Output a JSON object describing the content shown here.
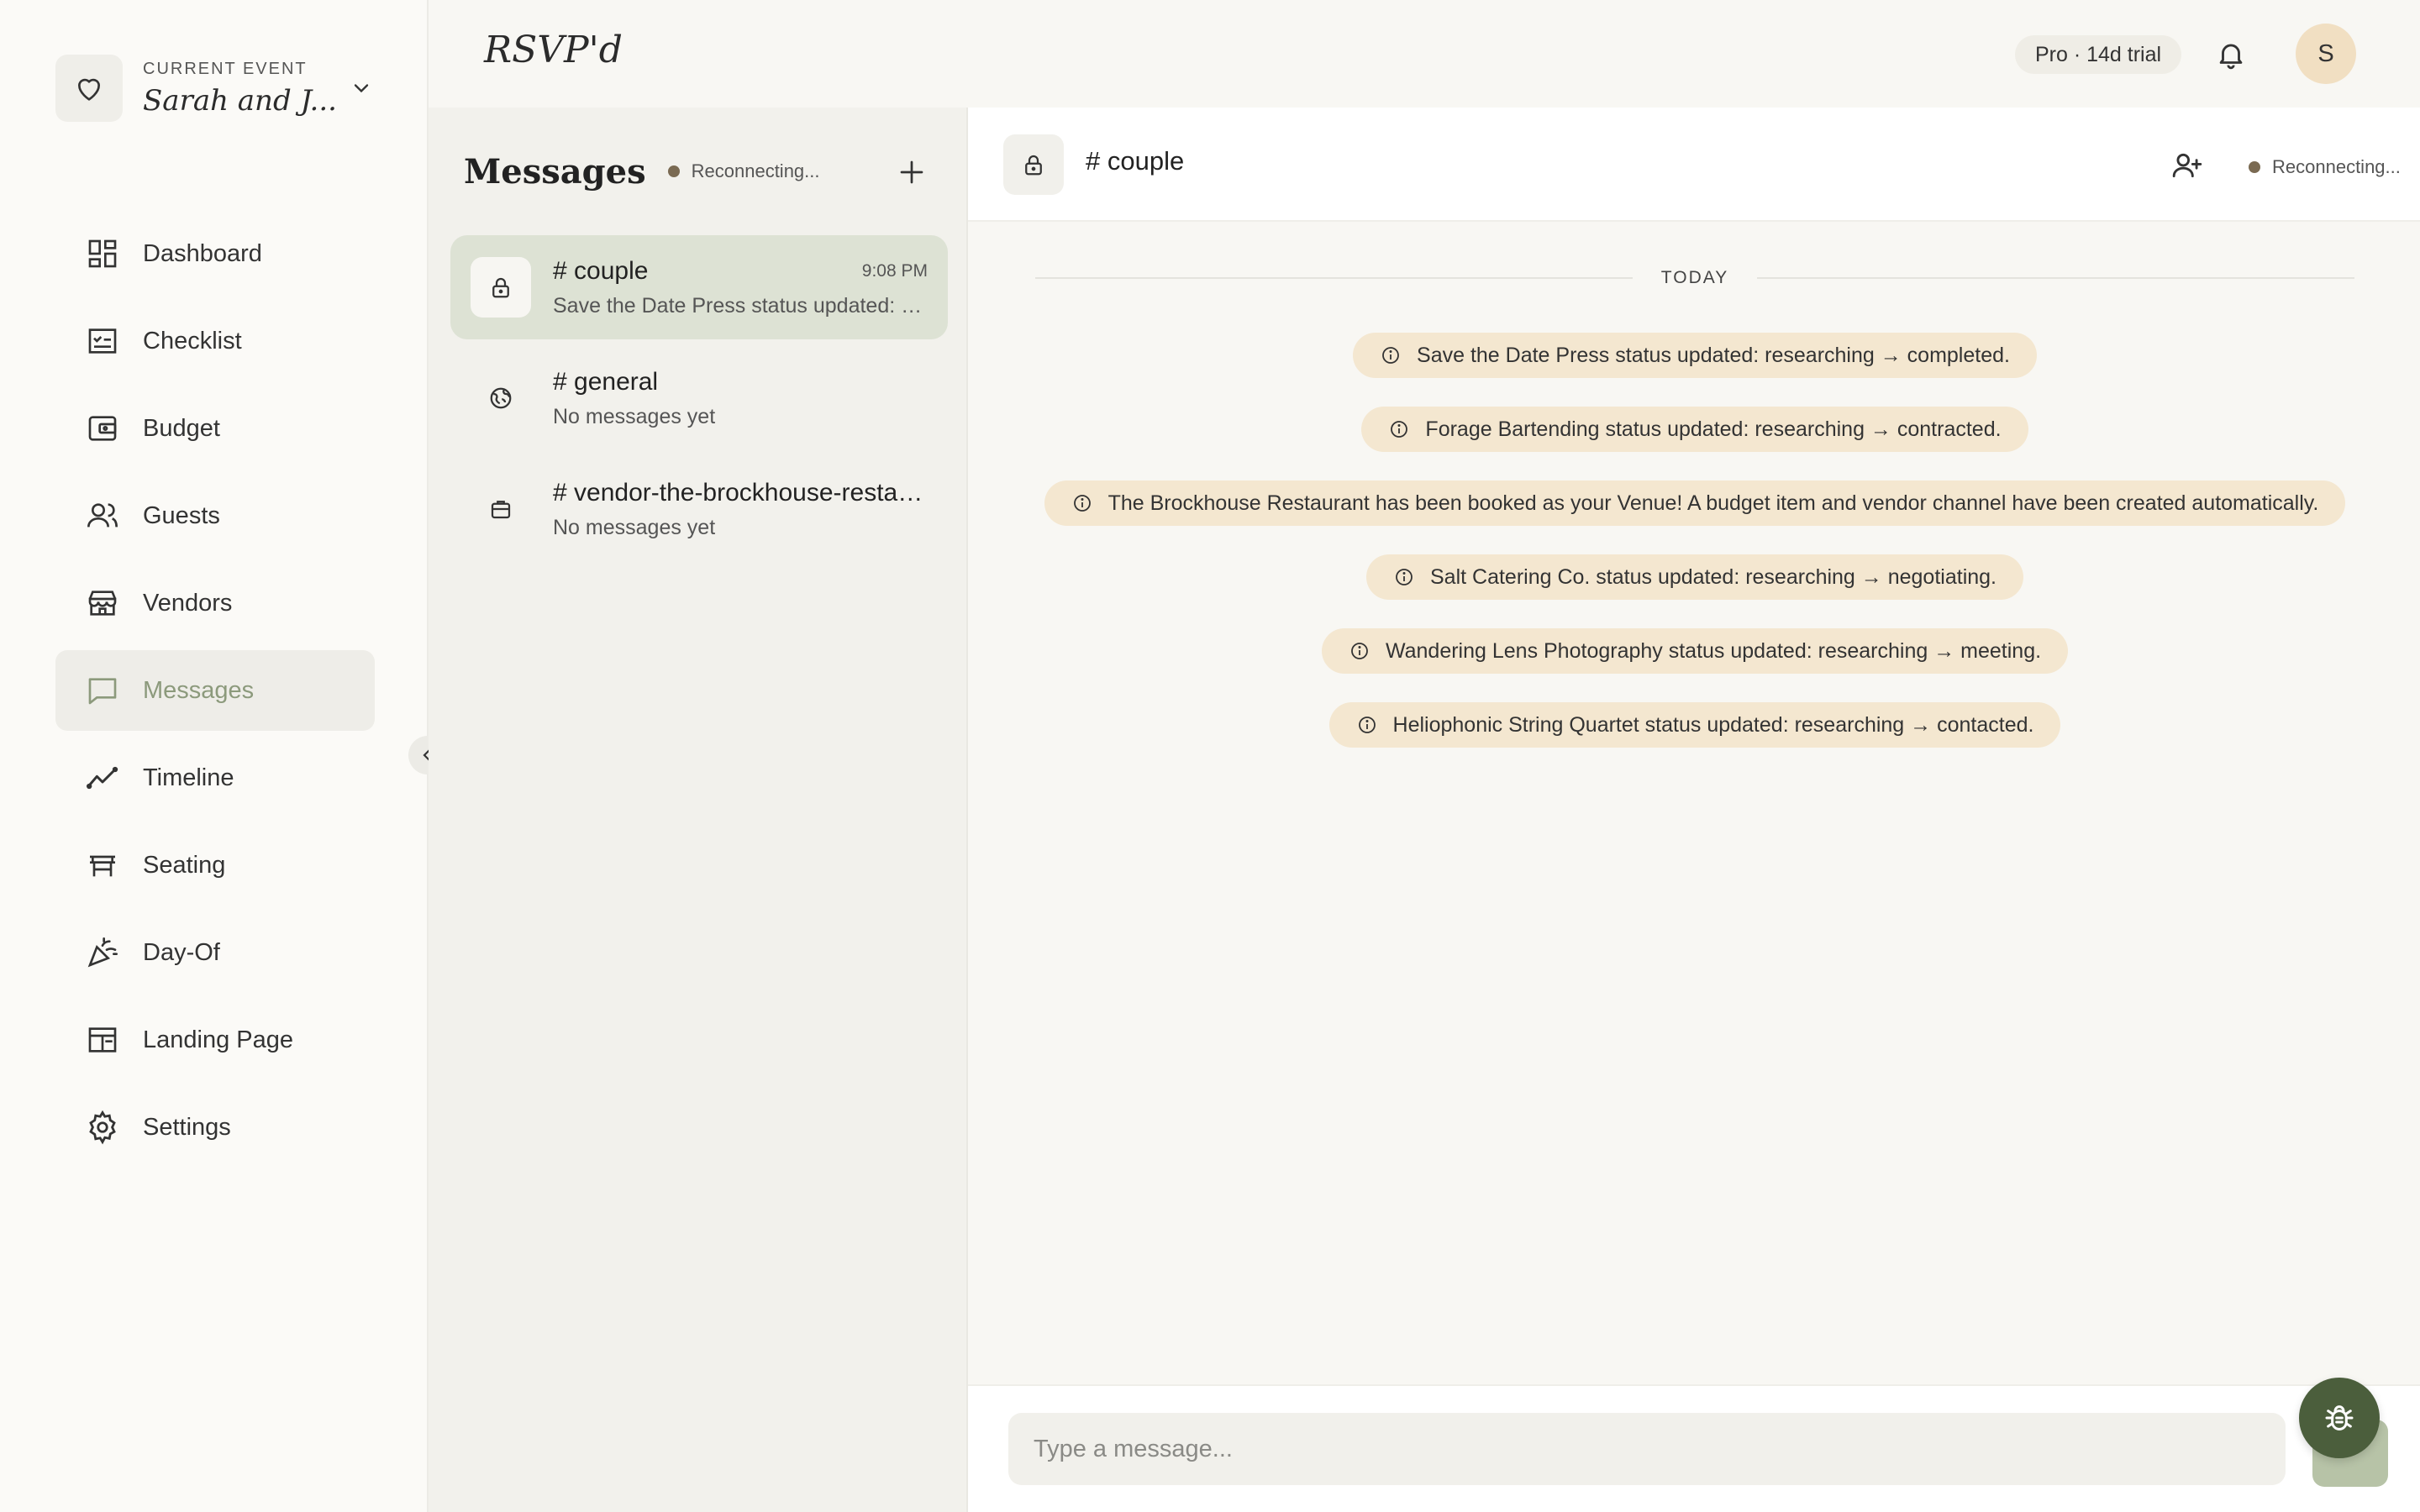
{
  "event": {
    "label": "CURRENT EVENT",
    "name": "Sarah and J..."
  },
  "sidebar": {
    "items": [
      {
        "label": "Dashboard",
        "icon": "dashboard-icon"
      },
      {
        "label": "Checklist",
        "icon": "checklist-icon"
      },
      {
        "label": "Budget",
        "icon": "wallet-icon"
      },
      {
        "label": "Guests",
        "icon": "users-icon"
      },
      {
        "label": "Vendors",
        "icon": "storefront-icon"
      },
      {
        "label": "Messages",
        "icon": "chat-icon",
        "active": true
      },
      {
        "label": "Timeline",
        "icon": "trend-icon"
      },
      {
        "label": "Seating",
        "icon": "table-icon"
      },
      {
        "label": "Day-Of",
        "icon": "party-popper-icon"
      },
      {
        "label": "Landing Page",
        "icon": "layout-icon"
      },
      {
        "label": "Settings",
        "icon": "gear-icon"
      }
    ]
  },
  "topbar": {
    "brand": "RSVP'd",
    "plan_badge": "Pro · 14d trial",
    "avatar_initial": "S"
  },
  "channels": {
    "title": "Messages",
    "status": "Reconnecting...",
    "list": [
      {
        "name": "# couple",
        "time": "9:08 PM",
        "preview": "Save the Date Press status updated: researching → completed.",
        "icon": "lock-icon",
        "active": true
      },
      {
        "name": "# general",
        "time": "",
        "preview": "No messages yet",
        "icon": "globe-icon"
      },
      {
        "name": "# vendor-the-brockhouse-restaurant",
        "time": "",
        "preview": "No messages yet",
        "icon": "briefcase-icon"
      }
    ]
  },
  "chat": {
    "title": "# couple",
    "status": "Reconnecting...",
    "day_label": "TODAY",
    "events": [
      "Save the Date Press status updated: researching → completed.",
      "Forage Bartending status updated: researching → contracted.",
      "The Brockhouse Restaurant has been booked as your Venue! A budget item and vendor channel have been created automatically.",
      "Salt Catering Co. status updated: researching → negotiating.",
      "Wandering Lens Photography status updated: researching → meeting.",
      "Heliophonic String Quartet status updated: researching → contacted."
    ],
    "input_placeholder": "Type a message..."
  },
  "colors": {
    "accent": "#4b5e3c",
    "active_nav_text": "#8c9a7c",
    "active_channel_bg": "#dde2d4",
    "event_pill_bg": "#f4e7d0",
    "status_dot": "#7a6a52"
  }
}
